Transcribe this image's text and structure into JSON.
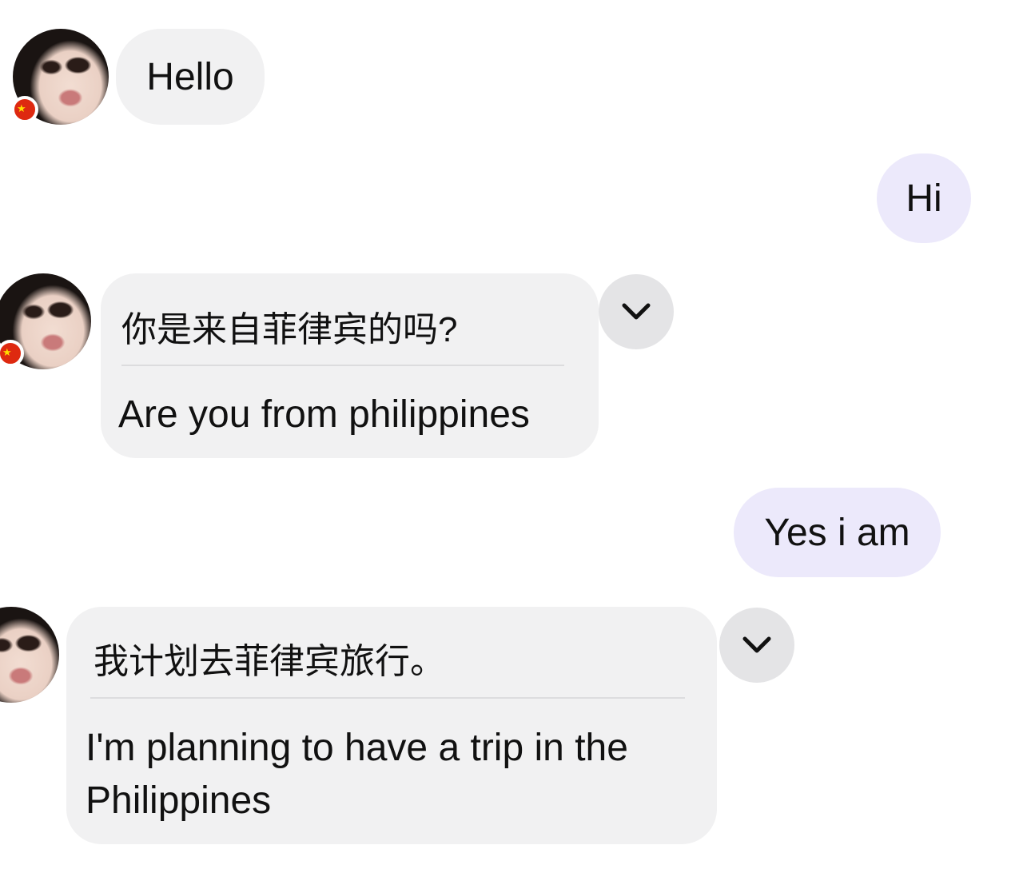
{
  "messages": [
    {
      "from": "them",
      "text": "Hello"
    },
    {
      "from": "me",
      "text": "Hi"
    },
    {
      "from": "them",
      "original": "你是来自菲律宾的吗?",
      "translation": "Are you from philippines"
    },
    {
      "from": "me",
      "text": "Yes i am"
    },
    {
      "from": "them",
      "original": "我计划去菲律宾旅行。",
      "translation": "I'm planning to have a trip in the Philippines"
    }
  ],
  "contact": {
    "avatar_icon": "profile-photo",
    "flag_icon": "china-flag-icon",
    "flag_glyph": "★"
  },
  "icons": {
    "expand": "chevron-down-icon"
  },
  "colors": {
    "incoming_bubble": "#f1f1f2",
    "outgoing_bubble": "#ece9fb",
    "chevron_button": "#e4e4e6",
    "flag_red": "#de2910",
    "flag_star": "#ffde00"
  }
}
